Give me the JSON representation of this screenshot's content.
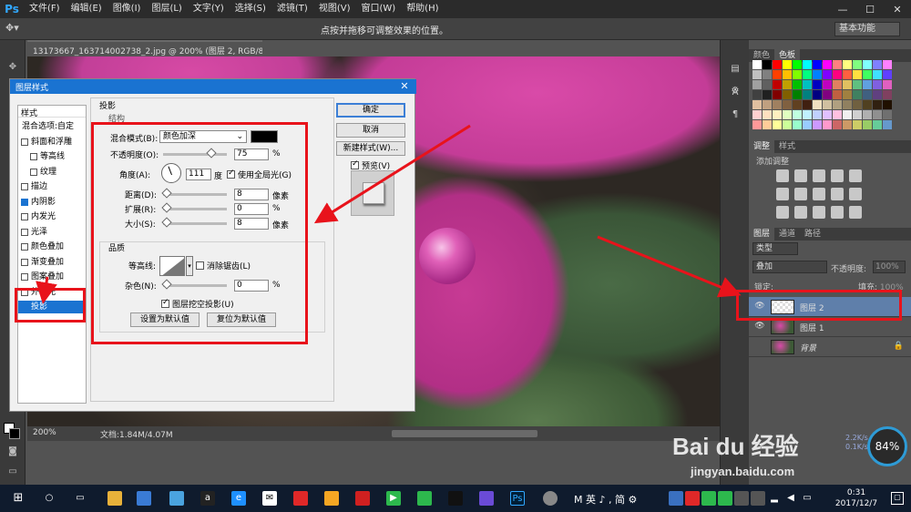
{
  "app": {
    "logo": "Ps"
  },
  "menu": [
    "文件(F)",
    "编辑(E)",
    "图像(I)",
    "图层(L)",
    "文字(Y)",
    "选择(S)",
    "滤镜(T)",
    "视图(V)",
    "窗口(W)",
    "帮助(H)"
  ],
  "window_controls": {
    "minimize": "—",
    "maximize": "☐",
    "close": "✕"
  },
  "options_bar": {
    "hint": "点按并拖移可调整效果的位置。",
    "workspace": "基本功能"
  },
  "document": {
    "tab_title": "13173667_163714002738_2.jpg @ 200% (图层 2, RGB/8#) *",
    "zoom": "200%",
    "doc_size": "文档:1.84M/4.07M"
  },
  "panels": {
    "color_tabs": [
      "颜色",
      "色板"
    ],
    "adjust_tabs": [
      "调整",
      "样式"
    ],
    "adjust_label": "添加调整",
    "layers_tabs": [
      "图层",
      "通道",
      "路径"
    ],
    "filter_kind": "类型",
    "blend_mode": "叠加",
    "opacity_label": "不透明度:",
    "opacity_value": "100%",
    "lock_label": "锁定:",
    "fill_label": "填充:",
    "fill_value": "100%",
    "layers": [
      {
        "name": "图层 2",
        "selected": true
      },
      {
        "name": "图层 1",
        "selected": false
      },
      {
        "name": "背景",
        "selected": false
      }
    ]
  },
  "swatch_colors": [
    "#ffffff",
    "#000000",
    "#ff0000",
    "#ffff00",
    "#00ff00",
    "#00ffff",
    "#0000ff",
    "#ff00ff",
    "#ff8080",
    "#ffff80",
    "#80ff80",
    "#80ffff",
    "#8080ff",
    "#ff80ff",
    "#c0c0c0",
    "#808080",
    "#ff4000",
    "#ffc000",
    "#80ff00",
    "#00ff80",
    "#0080ff",
    "#8000ff",
    "#ff0080",
    "#ff6040",
    "#ffe040",
    "#40ff60",
    "#40e0ff",
    "#6040ff",
    "#a0a0a0",
    "#606060",
    "#c00000",
    "#c0a000",
    "#00c000",
    "#00c0c0",
    "#0000c0",
    "#c000c0",
    "#e08060",
    "#e0c060",
    "#60c080",
    "#60a0e0",
    "#8060e0",
    "#e060c0",
    "#404040",
    "#202020",
    "#800000",
    "#806000",
    "#008000",
    "#008080",
    "#000080",
    "#800080",
    "#c06040",
    "#a08040",
    "#408060",
    "#406080",
    "#604080",
    "#804060",
    "#e0c0a0",
    "#c0a080",
    "#a08060",
    "#806040",
    "#604020",
    "#402010",
    "#f0e0c0",
    "#d0c0a0",
    "#b0a080",
    "#908060",
    "#706040",
    "#504020",
    "#302010",
    "#201000",
    "#ffd0d0",
    "#ffe0c0",
    "#fff0c0",
    "#e0ffc0",
    "#c0ffe0",
    "#c0f0ff",
    "#c0d0ff",
    "#e0c0ff",
    "#ffc0e0",
    "#f0f0f0",
    "#d0d0d0",
    "#b0b0b0",
    "#909090",
    "#707070",
    "#ff9999",
    "#ffcc99",
    "#ffff99",
    "#ccff99",
    "#99ffcc",
    "#99ccff",
    "#cc99ff",
    "#ff99cc",
    "#cc6666",
    "#cc9966",
    "#cccc66",
    "#99cc66",
    "#66cc99",
    "#6699cc"
  ],
  "dialog": {
    "title": "图层样式",
    "close": "✕",
    "style_list_header": "样式",
    "style_items": [
      {
        "label": "混合选项:自定",
        "checkbox": false,
        "checked": false,
        "sub": false,
        "active": false
      },
      {
        "label": "斜面和浮雕",
        "checkbox": true,
        "checked": false,
        "sub": false,
        "active": false
      },
      {
        "label": "等高线",
        "checkbox": true,
        "checked": false,
        "sub": true,
        "active": false
      },
      {
        "label": "纹理",
        "checkbox": true,
        "checked": false,
        "sub": true,
        "active": false
      },
      {
        "label": "描边",
        "checkbox": true,
        "checked": false,
        "sub": false,
        "active": false
      },
      {
        "label": "内阴影",
        "checkbox": true,
        "checked": true,
        "sub": false,
        "active": false
      },
      {
        "label": "内发光",
        "checkbox": true,
        "checked": false,
        "sub": false,
        "active": false
      },
      {
        "label": "光泽",
        "checkbox": true,
        "checked": false,
        "sub": false,
        "active": false
      },
      {
        "label": "颜色叠加",
        "checkbox": true,
        "checked": false,
        "sub": false,
        "active": false
      },
      {
        "label": "渐变叠加",
        "checkbox": true,
        "checked": false,
        "sub": false,
        "active": false
      },
      {
        "label": "图案叠加",
        "checkbox": true,
        "checked": false,
        "sub": false,
        "active": false
      },
      {
        "label": "外发光",
        "checkbox": true,
        "checked": false,
        "sub": false,
        "active": false
      },
      {
        "label": "投影",
        "checkbox": true,
        "checked": true,
        "sub": false,
        "active": true
      }
    ],
    "section_title": "投影",
    "structure_title": "结构",
    "blend_mode_label": "混合模式(B):",
    "blend_mode_value": "颜色加深",
    "shadow_color": "#000000",
    "opacity_label": "不透明度(O):",
    "opacity_value": "75",
    "opacity_fraction": 0.75,
    "percent": "%",
    "angle_label": "角度(A):",
    "angle_value": "111",
    "angle_unit": "度",
    "global_light_label": "使用全局光(G)",
    "global_light_checked": true,
    "distance_label": "距离(D):",
    "distance_value": "8",
    "spread_label": "扩展(R):",
    "spread_value": "0",
    "size_label": "大小(S):",
    "size_value": "8",
    "pixels_unit": "像素",
    "quality_title": "品质",
    "contour_label": "等高线:",
    "antialias_label": "消除锯齿(L)",
    "noise_label": "杂色(N):",
    "noise_value": "0",
    "knockout_label": "图层挖空投影(U)",
    "set_default_button": "设置为默认值",
    "reset_default_button": "复位为默认值",
    "ok_button": "确定",
    "cancel_button": "取消",
    "new_style_button": "新建样式(W)...",
    "preview_label": "预览(V)"
  },
  "watermark": {
    "logo": "Bai du 经验",
    "url": "jingyan.baidu.com"
  },
  "system": {
    "perf": "84%",
    "net_up": "2.2K/s",
    "net_down": "0.1K/s",
    "ime": "M 英 ♪ , 简 ⚙",
    "time": "0:31",
    "date": "2017/12/7",
    "notify": "▢"
  }
}
